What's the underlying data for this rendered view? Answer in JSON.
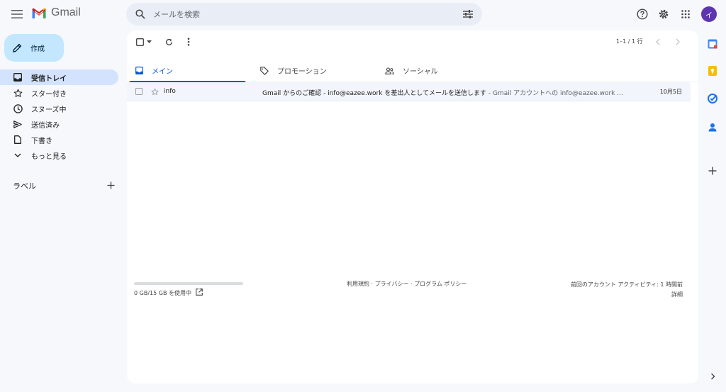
{
  "app": {
    "title": "Gmail"
  },
  "search": {
    "placeholder": "メールを検索"
  },
  "compose": {
    "label": "作成"
  },
  "sidebar": {
    "items": [
      {
        "label": "受信トレイ",
        "icon": "inbox-icon",
        "active": true
      },
      {
        "label": "スター付き",
        "icon": "star-icon"
      },
      {
        "label": "スヌーズ中",
        "icon": "clock-icon"
      },
      {
        "label": "送信済み",
        "icon": "send-icon"
      },
      {
        "label": "下書き",
        "icon": "draft-icon"
      },
      {
        "label": "もっと見る",
        "icon": "chevron-down-icon"
      }
    ],
    "labels_title": "ラベル"
  },
  "toolbar": {
    "range": "1–1 / 1 行"
  },
  "tabs": [
    {
      "label": "メイン",
      "icon": "inbox-icon",
      "active": true
    },
    {
      "label": "プロモーション",
      "icon": "tag-icon"
    },
    {
      "label": "ソーシャル",
      "icon": "people-icon"
    }
  ],
  "emails": [
    {
      "sender": "info",
      "subject": "Gmail からのご確認 - info@eazee.work を差出人としてメールを送信します",
      "separator": " - ",
      "snippet": "Gmail アカウントへの info@eazee.work ...",
      "date": "10月5日"
    }
  ],
  "footer": {
    "storage": "0 GB/15 GB を使用中",
    "links": "利用規約 · プライバシー · プログラム ポリシー",
    "activity": "前回のアカウント アクティビティ: 1 時間前",
    "details": "詳細"
  },
  "account": {
    "avatar_letter": "イ"
  },
  "colors": {
    "accent": "#0b57d0",
    "compose_bg": "#c2e7ff",
    "active_nav": "#d3e3fd",
    "avatar": "#5e35b1"
  }
}
